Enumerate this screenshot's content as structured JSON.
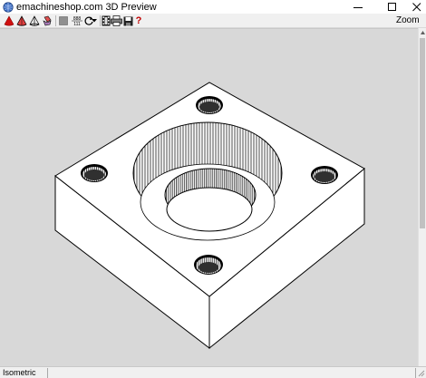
{
  "window": {
    "title": "emachineshop.com 3D Preview",
    "app_icon": "emachineshop-globe-icon"
  },
  "titlebar_controls": [
    "minimize-icon",
    "maximize-icon",
    "close-icon"
  ],
  "toolbar": {
    "buttons": [
      "red-cone-icon",
      "red-cone-outline-icon",
      "wireframe-cone-icon",
      "layered-shapes-icon",
      "gray-square-icon",
      "dimension-numbers-icon",
      "rotate-icon",
      "dropdown-arrow-icon",
      "film-icon",
      "printer-icon",
      "save-disk-icon",
      "help-icon"
    ],
    "numbers_icon_text_top": "888",
    "numbers_icon_text_bottom": "111",
    "help_glyph": "?",
    "zoom_label": "Zoom"
  },
  "viewport": {
    "background": "#d8d8d8",
    "model": "square-plate-with-counterbored-center-hole-and-four-corner-holes"
  },
  "status": {
    "view_mode": "Isometric"
  },
  "colors": {
    "accent_red": "#d01010",
    "model_fill": "#ffffff",
    "model_stroke": "#000000"
  }
}
